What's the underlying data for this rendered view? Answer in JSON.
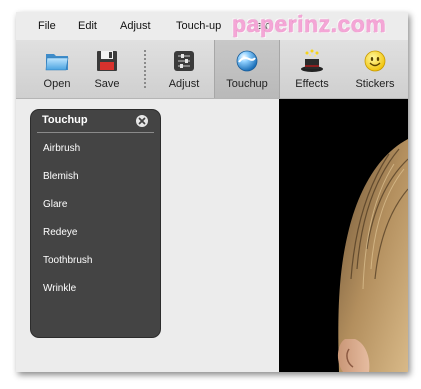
{
  "menu": {
    "file": "File",
    "edit": "Edit",
    "adjust": "Adjust",
    "touchup": "Touch-up",
    "help": "Help"
  },
  "brand": {
    "logo_text": "paperinz.com"
  },
  "toolbar": {
    "open": {
      "label": "Open",
      "icon": "folder-icon"
    },
    "save": {
      "label": "Save",
      "icon": "floppy-disk-icon"
    },
    "adjust": {
      "label": "Adjust",
      "icon": "sliders-icon"
    },
    "touchup": {
      "label": "Touchup",
      "icon": "touchup-sphere-icon",
      "active": true
    },
    "effects": {
      "label": "Effects",
      "icon": "magic-hat-icon"
    },
    "stickers": {
      "label": "Stickers",
      "icon": "smiley-icon"
    }
  },
  "panel": {
    "title": "Touchup",
    "items": [
      "Airbrush",
      "Blemish",
      "Glare",
      "Redeye",
      "Toothbrush",
      "Wrinkle"
    ]
  },
  "colors": {
    "panel_bg": "#444444",
    "toolbar_bg": "#d6d6d6",
    "canvas_bg": "#000000",
    "accent": "#2f8ed8"
  }
}
